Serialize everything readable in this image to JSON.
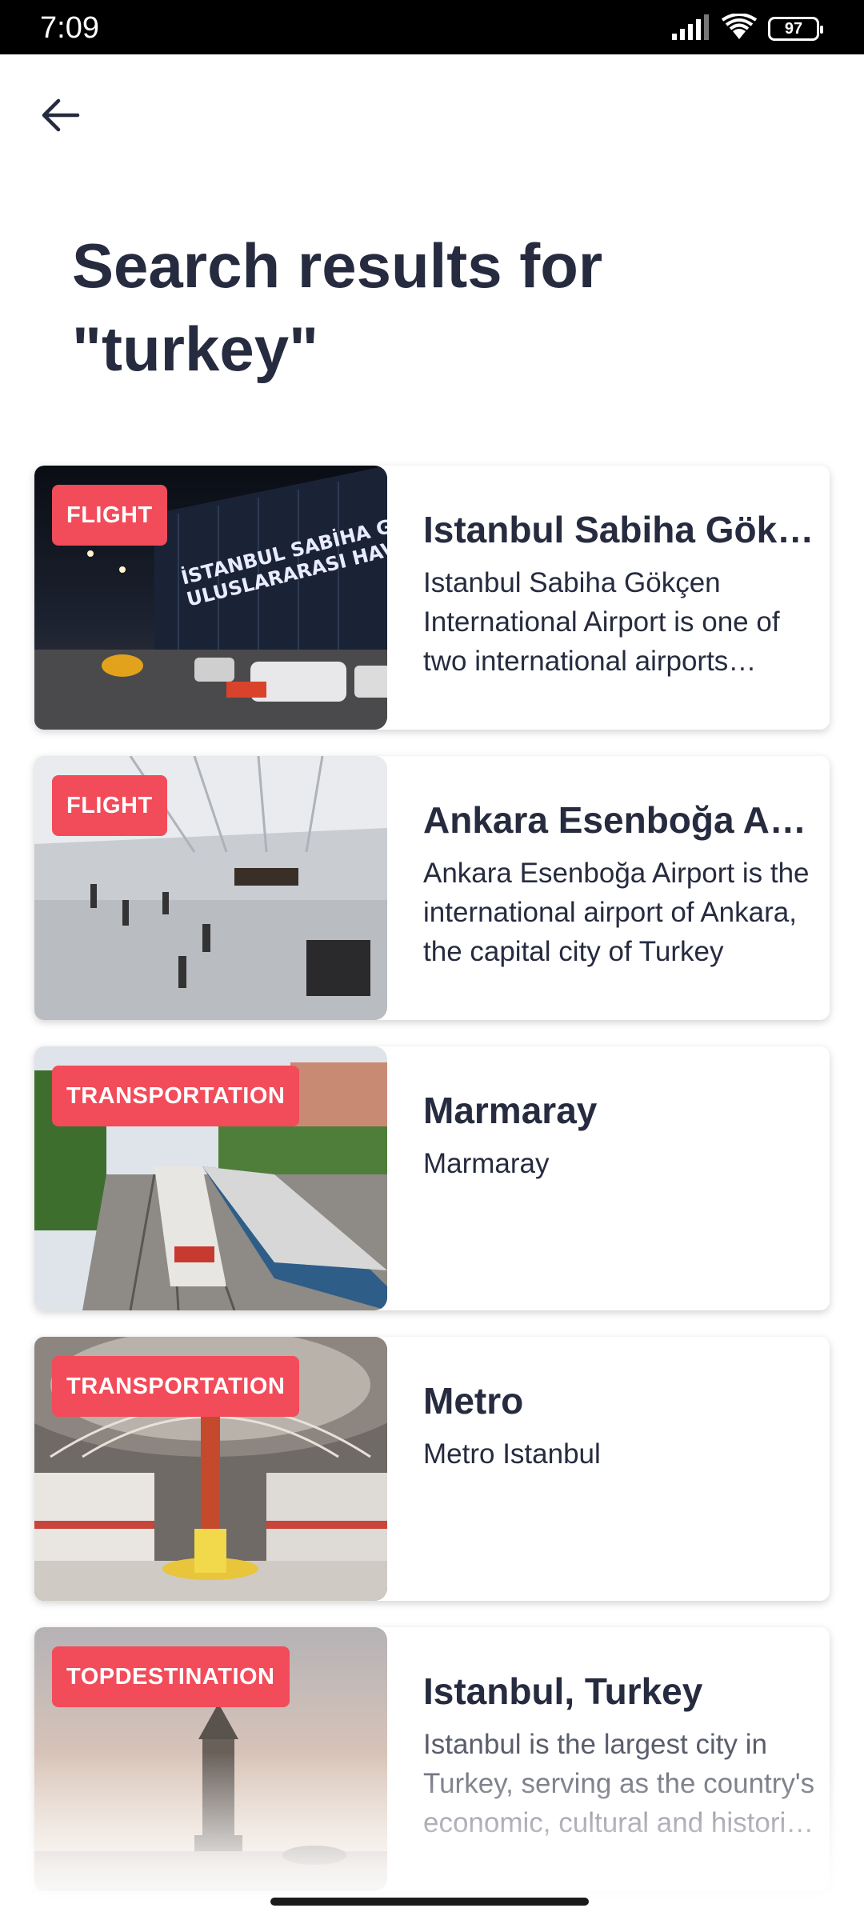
{
  "status_bar": {
    "time": "7:09",
    "battery": "97",
    "icons": [
      "signal-icon",
      "wifi-icon",
      "battery-icon"
    ]
  },
  "header": {
    "back_icon": "arrow-left-icon",
    "title": "Search results for \"turkey\""
  },
  "colors": {
    "badge": "#f24b5a",
    "title_text": "#262b3f"
  },
  "results": [
    {
      "badge": "FLIGHT",
      "title": "Istanbul Sabiha Gökçen International Airport",
      "description": "Istanbul Sabiha Gökçen International Airport is one of two international airports serving Istanbul",
      "image_text_line1": "İSTANBUL SABİHA GÖKÇEN",
      "image_text_line2": "ULUSLARARASI HAVALİMANI"
    },
    {
      "badge": "FLIGHT",
      "title": "Ankara Esenboğa Airport",
      "description": "Ankara Esenboğa Airport is the international airport of Ankara, the capital city of Turkey"
    },
    {
      "badge": "TRANSPORTATION",
      "title": "Marmaray",
      "description": "Marmaray"
    },
    {
      "badge": "TRANSPORTATION",
      "title": "Metro",
      "description": "Metro Istanbul"
    },
    {
      "badge": "TOPDESTINATION",
      "title": "Istanbul, Turkey",
      "description": "Istanbul is the largest city in Turkey, serving as the country's economic, cultural and historic hub"
    }
  ]
}
